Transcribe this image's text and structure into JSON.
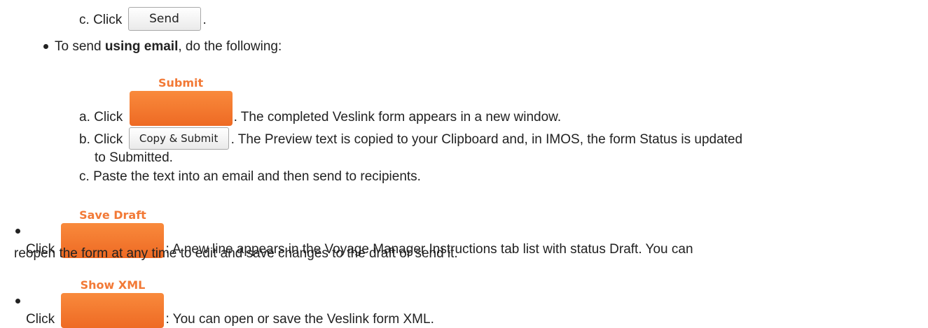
{
  "steps": {
    "c_send": {
      "marker": "c.",
      "click": "Click",
      "button": "Send",
      "after": "."
    },
    "email_intro": {
      "pre": "To send ",
      "bold": "using email",
      "post": ", do the following:"
    },
    "a_submit": {
      "marker": "a.",
      "click": "Click",
      "button": "Submit",
      "after": ". The completed Veslink form appears in a new window."
    },
    "b_copy": {
      "marker": "b.",
      "click": "Click",
      "button": "Copy & Submit",
      "after": ". The Preview text is copied to your Clipboard and, in IMOS, the form Status is updated",
      "continuation": "to Submitted."
    },
    "c_paste": {
      "marker": "c.",
      "text": "Paste the text into an email and then send to recipients."
    }
  },
  "save_draft": {
    "click": "Click",
    "button": "Save Draft",
    "after": ": A new line appears in the Voyage Manager Instructions tab list with status Draft. You can",
    "continuation": "reopen the form at any time to edit and save changes to the draft or send it."
  },
  "show_xml": {
    "click": "Click",
    "button": "Show XML",
    "after": ": You can open or save the Veslink form XML."
  }
}
